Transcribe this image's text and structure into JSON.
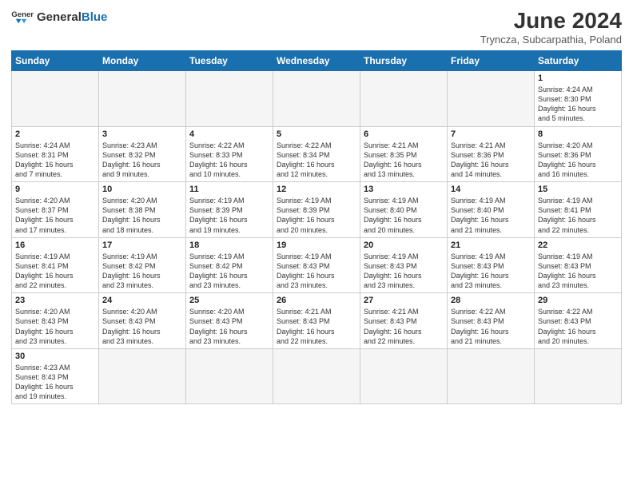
{
  "header": {
    "logo_general": "General",
    "logo_blue": "Blue",
    "title": "June 2024",
    "subtitle": "Tryncza, Subcarpathia, Poland"
  },
  "weekdays": [
    "Sunday",
    "Monday",
    "Tuesday",
    "Wednesday",
    "Thursday",
    "Friday",
    "Saturday"
  ],
  "weeks": [
    [
      {
        "day": "",
        "empty": true
      },
      {
        "day": "",
        "empty": true
      },
      {
        "day": "",
        "empty": true
      },
      {
        "day": "",
        "empty": true
      },
      {
        "day": "",
        "empty": true
      },
      {
        "day": "",
        "empty": true
      },
      {
        "day": "1",
        "info": "Sunrise: 4:24 AM\nSunset: 8:30 PM\nDaylight: 16 hours\nand 5 minutes."
      }
    ],
    [
      {
        "day": "2",
        "info": "Sunrise: 4:24 AM\nSunset: 8:31 PM\nDaylight: 16 hours\nand 7 minutes."
      },
      {
        "day": "3",
        "info": "Sunrise: 4:23 AM\nSunset: 8:32 PM\nDaylight: 16 hours\nand 9 minutes."
      },
      {
        "day": "4",
        "info": "Sunrise: 4:22 AM\nSunset: 8:33 PM\nDaylight: 16 hours\nand 10 minutes."
      },
      {
        "day": "5",
        "info": "Sunrise: 4:22 AM\nSunset: 8:34 PM\nDaylight: 16 hours\nand 12 minutes."
      },
      {
        "day": "6",
        "info": "Sunrise: 4:21 AM\nSunset: 8:35 PM\nDaylight: 16 hours\nand 13 minutes."
      },
      {
        "day": "7",
        "info": "Sunrise: 4:21 AM\nSunset: 8:36 PM\nDaylight: 16 hours\nand 14 minutes."
      },
      {
        "day": "8",
        "info": "Sunrise: 4:20 AM\nSunset: 8:36 PM\nDaylight: 16 hours\nand 16 minutes."
      }
    ],
    [
      {
        "day": "9",
        "info": "Sunrise: 4:20 AM\nSunset: 8:37 PM\nDaylight: 16 hours\nand 17 minutes."
      },
      {
        "day": "10",
        "info": "Sunrise: 4:20 AM\nSunset: 8:38 PM\nDaylight: 16 hours\nand 18 minutes."
      },
      {
        "day": "11",
        "info": "Sunrise: 4:19 AM\nSunset: 8:39 PM\nDaylight: 16 hours\nand 19 minutes."
      },
      {
        "day": "12",
        "info": "Sunrise: 4:19 AM\nSunset: 8:39 PM\nDaylight: 16 hours\nand 20 minutes."
      },
      {
        "day": "13",
        "info": "Sunrise: 4:19 AM\nSunset: 8:40 PM\nDaylight: 16 hours\nand 20 minutes."
      },
      {
        "day": "14",
        "info": "Sunrise: 4:19 AM\nSunset: 8:40 PM\nDaylight: 16 hours\nand 21 minutes."
      },
      {
        "day": "15",
        "info": "Sunrise: 4:19 AM\nSunset: 8:41 PM\nDaylight: 16 hours\nand 22 minutes."
      }
    ],
    [
      {
        "day": "16",
        "info": "Sunrise: 4:19 AM\nSunset: 8:41 PM\nDaylight: 16 hours\nand 22 minutes."
      },
      {
        "day": "17",
        "info": "Sunrise: 4:19 AM\nSunset: 8:42 PM\nDaylight: 16 hours\nand 23 minutes."
      },
      {
        "day": "18",
        "info": "Sunrise: 4:19 AM\nSunset: 8:42 PM\nDaylight: 16 hours\nand 23 minutes."
      },
      {
        "day": "19",
        "info": "Sunrise: 4:19 AM\nSunset: 8:43 PM\nDaylight: 16 hours\nand 23 minutes."
      },
      {
        "day": "20",
        "info": "Sunrise: 4:19 AM\nSunset: 8:43 PM\nDaylight: 16 hours\nand 23 minutes."
      },
      {
        "day": "21",
        "info": "Sunrise: 4:19 AM\nSunset: 8:43 PM\nDaylight: 16 hours\nand 23 minutes."
      },
      {
        "day": "22",
        "info": "Sunrise: 4:19 AM\nSunset: 8:43 PM\nDaylight: 16 hours\nand 23 minutes."
      }
    ],
    [
      {
        "day": "23",
        "info": "Sunrise: 4:20 AM\nSunset: 8:43 PM\nDaylight: 16 hours\nand 23 minutes."
      },
      {
        "day": "24",
        "info": "Sunrise: 4:20 AM\nSunset: 8:43 PM\nDaylight: 16 hours\nand 23 minutes."
      },
      {
        "day": "25",
        "info": "Sunrise: 4:20 AM\nSunset: 8:43 PM\nDaylight: 16 hours\nand 23 minutes."
      },
      {
        "day": "26",
        "info": "Sunrise: 4:21 AM\nSunset: 8:43 PM\nDaylight: 16 hours\nand 22 minutes."
      },
      {
        "day": "27",
        "info": "Sunrise: 4:21 AM\nSunset: 8:43 PM\nDaylight: 16 hours\nand 22 minutes."
      },
      {
        "day": "28",
        "info": "Sunrise: 4:22 AM\nSunset: 8:43 PM\nDaylight: 16 hours\nand 21 minutes."
      },
      {
        "day": "29",
        "info": "Sunrise: 4:22 AM\nSunset: 8:43 PM\nDaylight: 16 hours\nand 20 minutes."
      }
    ],
    [
      {
        "day": "30",
        "info": "Sunrise: 4:23 AM\nSunset: 8:43 PM\nDaylight: 16 hours\nand 19 minutes."
      },
      {
        "day": "",
        "empty": true
      },
      {
        "day": "",
        "empty": true
      },
      {
        "day": "",
        "empty": true
      },
      {
        "day": "",
        "empty": true
      },
      {
        "day": "",
        "empty": true
      },
      {
        "day": "",
        "empty": true
      }
    ]
  ]
}
